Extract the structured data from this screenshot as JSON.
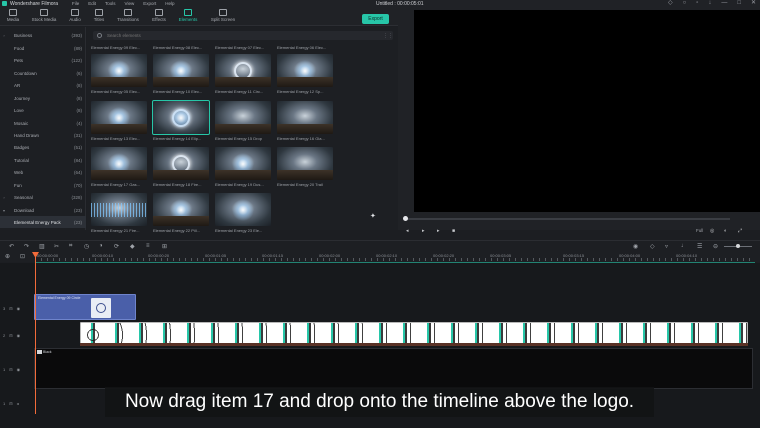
{
  "app": {
    "name": "Wondershare Filmora",
    "document_title": "Untitled : 00:00:05:01",
    "menus": [
      "File",
      "Edit",
      "Tools",
      "View",
      "Export",
      "Help"
    ]
  },
  "toolbar": {
    "tabs": [
      {
        "label": "Media",
        "icon": "media-icon"
      },
      {
        "label": "Stock Media",
        "icon": "stock-media-icon"
      },
      {
        "label": "Audio",
        "icon": "audio-icon"
      },
      {
        "label": "Titles",
        "icon": "titles-icon"
      },
      {
        "label": "Transitions",
        "icon": "transitions-icon"
      },
      {
        "label": "Effects",
        "icon": "effects-icon"
      },
      {
        "label": "Elements",
        "icon": "elements-icon",
        "active": true
      },
      {
        "label": "Split Screen",
        "icon": "split-screen-icon"
      }
    ],
    "export_label": "Export"
  },
  "sidebar": {
    "categories": [
      {
        "name": "Business",
        "count": "(393)"
      },
      {
        "name": "Food",
        "count": "(89)"
      },
      {
        "name": "Pets",
        "count": "(122)"
      },
      {
        "name": "Countdown",
        "count": "(6)"
      },
      {
        "name": "AR",
        "count": "(8)"
      },
      {
        "name": "Journey",
        "count": "(8)"
      },
      {
        "name": "Love",
        "count": "(8)"
      },
      {
        "name": "Mosaic",
        "count": "(4)"
      },
      {
        "name": "Hand Drawn",
        "count": "(31)"
      },
      {
        "name": "Badges",
        "count": "(51)"
      },
      {
        "name": "Tutorial",
        "count": "(84)"
      },
      {
        "name": "Web",
        "count": "(64)"
      },
      {
        "name": "Fun",
        "count": "(70)"
      },
      {
        "name": "Seasonal",
        "count": "(328)"
      },
      {
        "name": "Download",
        "count": "(23)"
      },
      {
        "name": "Elemental Energy Pack",
        "count": "(23)",
        "selected": true
      }
    ]
  },
  "media": {
    "search_placeholder": "Search elements",
    "items": [
      {
        "title": "Elemental Energy 09 Elec..."
      },
      {
        "title": "Elemental Energy 08 Elec..."
      },
      {
        "title": "Elemental Energy 07 Elec..."
      },
      {
        "title": "Elemental Energy 06 Elec..."
      },
      {
        "title": "Elemental Energy 05 Elec..."
      },
      {
        "title": "Elemental Energy 10 Elec..."
      },
      {
        "title": "Elemental Energy 11 Circ..."
      },
      {
        "title": "Elemental Energy 12 Sp..."
      },
      {
        "title": "Elemental Energy 13 Elec..."
      },
      {
        "title": "Elemental Energy 14 Elip..."
      },
      {
        "title": "Elemental Energy 15 Drop"
      },
      {
        "title": "Elemental Energy 16 Gla..."
      },
      {
        "title": "Elemental Energy 17 Gas..."
      },
      {
        "title": "Elemental Energy 18 Fire..."
      },
      {
        "title": "Elemental Energy 19 Dus..."
      },
      {
        "title": "Elemental Energy 20 Trail"
      },
      {
        "title": "Elemental Energy 21 Fire..."
      },
      {
        "title": "Elemental Energy 22 Pill..."
      },
      {
        "title": "Elemental Energy 23 Ele..."
      }
    ]
  },
  "preview": {
    "full_label": "Full"
  },
  "timeline": {
    "ruler_labels": [
      "00:00:00:00",
      "00:00:00:10",
      "00:00:00:20",
      "00:00:01:05",
      "00:00:01:15",
      "00:00:02:00",
      "00:00:02:10",
      "00:00:02:20",
      "00:00:03:05",
      "00:00:03:15",
      "00:00:04:00",
      "00:00:04:10"
    ],
    "clips": {
      "logo_clip": "Elemental Energy 09 Circle",
      "black_clip": "Black"
    },
    "track_numbers": [
      "3",
      "2",
      "1",
      "1"
    ]
  },
  "caption": "Now drag item 17 and drop onto the timeline above the logo.",
  "colors": {
    "accent": "#27c6a8",
    "playhead": "#f26b3a",
    "clip_blue": "#4a5fa9"
  }
}
